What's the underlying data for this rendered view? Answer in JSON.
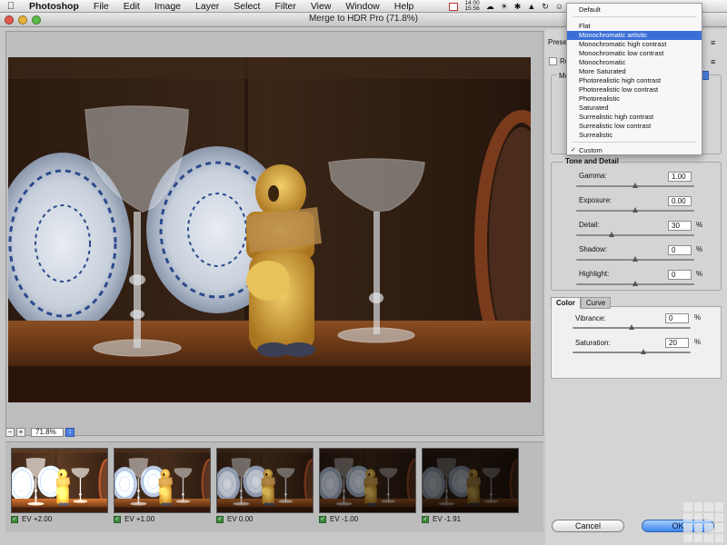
{
  "menubar": {
    "app_name": "Photoshop",
    "items": [
      "File",
      "Edit",
      "Image",
      "Layer",
      "Select",
      "Filter",
      "View",
      "Window",
      "Help"
    ],
    "clock_top": "14:00",
    "clock_bottom": "15:56"
  },
  "window": {
    "title": "Merge to HDR Pro (71.8%)"
  },
  "preview": {
    "zoom": "71.8%",
    "zoom_out": "−",
    "zoom_in": "+"
  },
  "filmstrip": {
    "thumbnails": [
      {
        "label": "EV +2.00",
        "brightness": 1.55
      },
      {
        "label": "EV +1.00",
        "brightness": 1.2
      },
      {
        "label": "EV 0.00",
        "brightness": 0.9
      },
      {
        "label": "EV -1.00",
        "brightness": 0.6
      },
      {
        "label": "EV -1.91",
        "brightness": 0.42
      }
    ]
  },
  "right_panel": {
    "preset_label": "Preset",
    "remove_ghosts_label": "Re",
    "mode_label": "Mo",
    "tone_detail_title": "Tone and Detail",
    "gamma": {
      "label": "Gamma:",
      "value": "1.00",
      "level": 0.5
    },
    "exposure": {
      "label": "Exposure:",
      "value": "0.00",
      "level": 0.5
    },
    "detail": {
      "label": "Detail:",
      "value": "30",
      "unit": "%",
      "level": 0.3
    },
    "shadow": {
      "label": "Shadow:",
      "value": "0",
      "unit": "%",
      "level": 0.5
    },
    "highlight": {
      "label": "Highlight:",
      "value": "0",
      "unit": "%",
      "level": 0.5
    },
    "tabs": [
      "Color",
      "Curve"
    ],
    "vibrance": {
      "label": "Vibrance:",
      "value": "0",
      "unit": "%",
      "level": 0.5
    },
    "saturation": {
      "label": "Saturation:",
      "value": "20",
      "unit": "%",
      "level": 0.6
    },
    "cancel_label": "Cancel",
    "ok_label": "OK"
  },
  "preset_menu": {
    "items": [
      "Default",
      "Flat",
      "Monochromatic artistic",
      "Monochromatic high contrast",
      "Monochromatic low contrast",
      "Monochromatic",
      "More Saturated",
      "Photorealistic high contrast",
      "Photorealistic low contrast",
      "Photorealistic",
      "Saturated",
      "Surrealistic high contrast",
      "Surrealistic low contrast",
      "Surrealistic",
      "Custom"
    ],
    "selected": "Monochromatic artistic",
    "checked": "Custom",
    "check_mark": "✓"
  },
  "colors": {
    "accent": "#3b6fd8",
    "ok_button": "#3a84e8"
  }
}
